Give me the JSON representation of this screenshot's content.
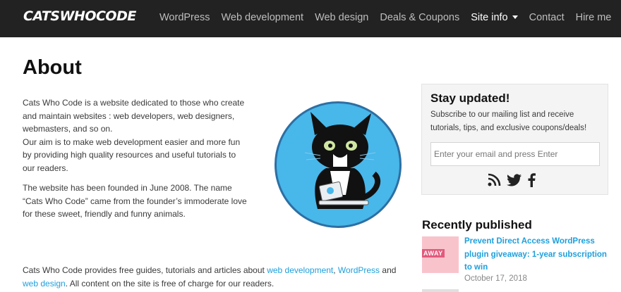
{
  "header": {
    "logo": "CATSWHOCODE",
    "nav": [
      {
        "label": "WordPress"
      },
      {
        "label": "Web development"
      },
      {
        "label": "Web design"
      },
      {
        "label": "Deals & Coupons"
      },
      {
        "label": "Site info",
        "has_dropdown": true,
        "active": true
      },
      {
        "label": "Contact"
      },
      {
        "label": "Hire me"
      }
    ]
  },
  "main": {
    "title": "About",
    "p1": "Cats Who Code is a website dedicated to those who create and maintain websites : web developers, web designers, webmasters, and so on.",
    "p1b": "Our aim is to make web development easier and more fun by providing high quality resources and useful tutorials to our readers.",
    "p2": "The website has been founded in June 2008. The name “Cats Who Code” came from the founder’s immoderate love for these sweet, friendly and funny animals.",
    "p3": {
      "before": "Cats Who Code provides free guides, tutorials and articles about ",
      "link1": "web development",
      "sep1": ", ",
      "link2": "WordPress",
      "sep2": " and ",
      "link3": "web design",
      "after": ". All content on the site is free of charge for our readers."
    }
  },
  "sidebar": {
    "newsletter": {
      "title": "Stay updated!",
      "text": "Subscribe to our mailing list and receive tutorials, tips, and exclusive coupons/deals!",
      "placeholder": "Enter your email and press Enter"
    },
    "social_icons": [
      "rss-icon",
      "twitter-icon",
      "facebook-icon"
    ],
    "recent": {
      "title": "Recently published",
      "posts": [
        {
          "title": "Prevent Direct Access WordPress plugin giveaway: 1-year subscription to win",
          "date": "October 17, 2018",
          "thumb_text": "AWAY"
        }
      ]
    }
  },
  "colors": {
    "header_bg": "#222222",
    "link": "#1e9fdc",
    "circle_bg": "#48b7ea"
  }
}
